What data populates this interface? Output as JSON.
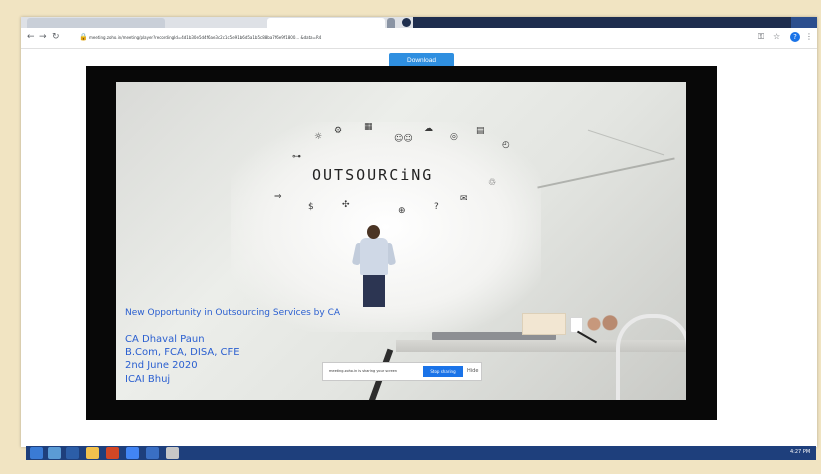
{
  "browser": {
    "address_bar": {
      "url": "meeting.zoho.in/meeting/player?recordingId=4d1b30e5d4f6ae3c2c1c5e91b6d5a1b5c88ba7f6e9f1800... &data=R4"
    },
    "profile_initial": "?"
  },
  "download_button": {
    "label": "Download"
  },
  "slide": {
    "heading": "OUTSOURCiNG",
    "subtitle": "New Opportunity in Outsourcing Services by CA",
    "presenter": {
      "name": "CA Dhaval Paun",
      "qualifications": "B.Com, FCA, DISA, CFE",
      "date": "2nd June 2020",
      "venue": "ICAI Bhuj"
    }
  },
  "toast": {
    "message": "meeting.zoho.in is sharing your screen",
    "stop_label": "Stop sharing",
    "hide_label": "Hide"
  },
  "taskbar": {
    "clock": "4:27 PM"
  }
}
